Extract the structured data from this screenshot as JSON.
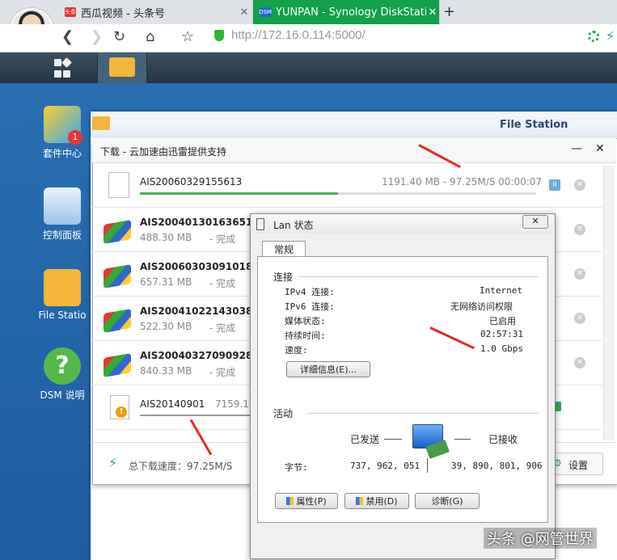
{
  "browser": {
    "tabs": [
      {
        "badge": "头条",
        "title": "西瓜视频 - 头条号",
        "close": "✕"
      },
      {
        "badge": "DSM",
        "title": "YUNPAN - Synology DiskStati",
        "close": "✕"
      }
    ],
    "new_tab": "+",
    "url": "http://172.16.0.114:5000/"
  },
  "desktop": {
    "icons": [
      {
        "label": "套件中心",
        "badge": "1"
      },
      {
        "label": "控制面板"
      },
      {
        "label": "File Statio"
      },
      {
        "label": "DSM 说明"
      }
    ]
  },
  "file_station": {
    "title": "File Station"
  },
  "download": {
    "title": "下载 - 云加速由迅雷提供支持",
    "active": {
      "name": "AIS20060329155613",
      "info": "1191.40 MB - 97.25M/S 00:00:07",
      "progress": 0.5
    },
    "items": [
      {
        "name": "AIS20040130163651",
        "size": "488.30 MB",
        "status": "- 完成"
      },
      {
        "name": "AIS20060303091018",
        "size": "657.31 MB",
        "status": "- 完成"
      },
      {
        "name": "AIS20041022143038",
        "size": "522.30 MB",
        "status": "- 完成"
      },
      {
        "name": "AIS20040327090928",
        "size": "840.33 MB",
        "status": "- 完成"
      }
    ],
    "warn_item": {
      "name": "AIS20140901",
      "size": "7159.10"
    },
    "total_speed": "总下载速度：97.25M/S",
    "settings": "设置"
  },
  "lan": {
    "title": "Lan 状态",
    "tab": "常规",
    "connection_heading": "连接",
    "rows": [
      {
        "k": "IPv4 连接:",
        "v": "Internet"
      },
      {
        "k": "IPv6 连接:",
        "v": "无网络访问权限"
      },
      {
        "k": "媒体状态:",
        "v": "已启用"
      },
      {
        "k": "持续时间:",
        "v": "02:57:31"
      },
      {
        "k": "速度:",
        "v": "1.0 Gbps"
      }
    ],
    "details_button": "详细信息(E)...",
    "activity_heading": "活动",
    "sent": "已发送",
    "received": "已接收",
    "bytes_label": "字节:",
    "bytes_sent": "737, 962, 051",
    "bytes_received": "39, 890, 801, 906",
    "buttons": [
      "属性(P)",
      "禁用(D)",
      "诊断(G)"
    ]
  },
  "watermark": "头条 @网管世界",
  "colors": {
    "accent_green": "#2eaa55",
    "arrow_red": "#e62b1e",
    "progress": "#4caf50"
  }
}
